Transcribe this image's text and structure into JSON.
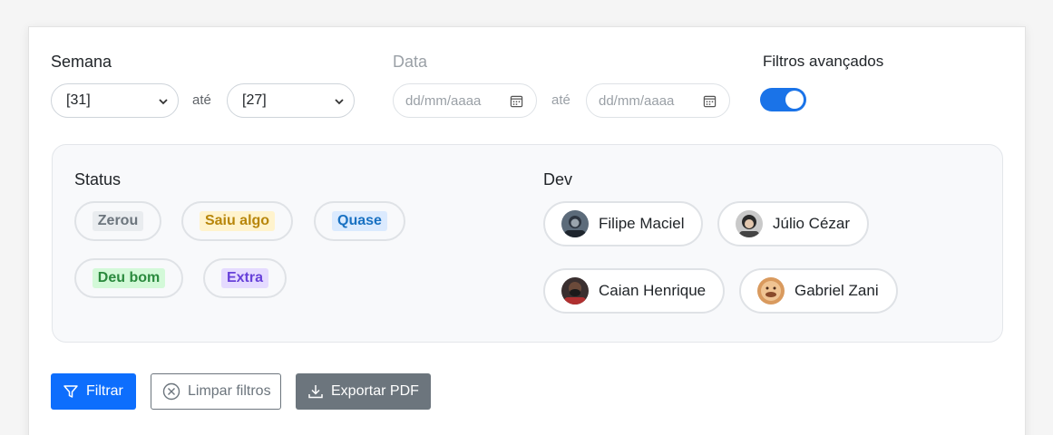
{
  "filters": {
    "semana_label": "Semana",
    "semana_from": "[31]",
    "semana_to": "[27]",
    "ate": "até",
    "data_label": "Data",
    "date_placeholder": "dd/mm/aaaa",
    "advanced_label": "Filtros avançados",
    "advanced_enabled": true
  },
  "status": {
    "title": "Status",
    "items": [
      {
        "label": "Zerou",
        "color": "#6c757d",
        "bg": "#e9ecef"
      },
      {
        "label": "Saiu algo",
        "color": "#b8860b",
        "bg": "#fff3cd"
      },
      {
        "label": "Quase",
        "color": "#1971c2",
        "bg": "#dbeafe"
      },
      {
        "label": "Deu bom",
        "color": "#2b8a3e",
        "bg": "#d3f9d8"
      },
      {
        "label": "Extra",
        "color": "#6741d9",
        "bg": "#e5dbff"
      }
    ]
  },
  "dev": {
    "title": "Dev",
    "items": [
      {
        "name": "Filipe Maciel",
        "icon": "avatar-filipe"
      },
      {
        "name": "Júlio Cézar",
        "icon": "avatar-julio"
      },
      {
        "name": "Caian Henrique",
        "icon": "avatar-caian"
      },
      {
        "name": "Gabriel Zani",
        "icon": "avatar-gabriel"
      }
    ]
  },
  "actions": {
    "filter_label": "Filtrar",
    "clear_label": "Limpar filtros",
    "export_label": "Exportar PDF",
    "primary_color": "#0d6efd",
    "secondary_color": "#6c757d"
  }
}
